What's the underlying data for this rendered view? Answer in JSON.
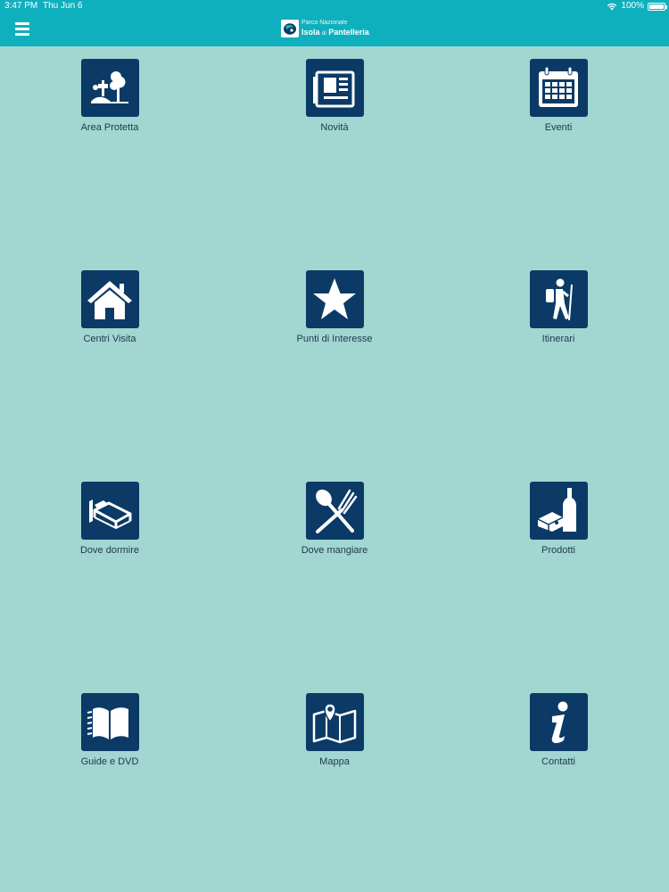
{
  "status": {
    "time": "3:47 PM",
    "date": "Thu Jun 6",
    "battery": "100%",
    "battery_level": 1.0
  },
  "header": {
    "logo_line1": "Parco Nazionale",
    "logo_line2a": "Isola",
    "logo_di": "di",
    "logo_line2b": "Pantelleria"
  },
  "menu": {
    "items": [
      {
        "label": "Area Protetta",
        "icon": "protected-area-icon"
      },
      {
        "label": "Novità",
        "icon": "newspaper-icon"
      },
      {
        "label": "Eventi",
        "icon": "calendar-icon"
      },
      {
        "label": "Centri Visita",
        "icon": "house-icon"
      },
      {
        "label": "Punti di Interesse",
        "icon": "star-icon"
      },
      {
        "label": "Itinerari",
        "icon": "hiker-icon"
      },
      {
        "label": "Dove dormire",
        "icon": "bed-icon"
      },
      {
        "label": "Dove mangiare",
        "icon": "fork-spoon-icon"
      },
      {
        "label": "Prodotti",
        "icon": "wine-cheese-icon"
      },
      {
        "label": "Guide e DVD",
        "icon": "book-icon"
      },
      {
        "label": "Mappa",
        "icon": "map-icon"
      },
      {
        "label": "Contatti",
        "icon": "info-icon"
      }
    ]
  },
  "colors": {
    "background": "#a2d6d1",
    "bar": "#0fb0be",
    "tile": "#0b3a66"
  }
}
